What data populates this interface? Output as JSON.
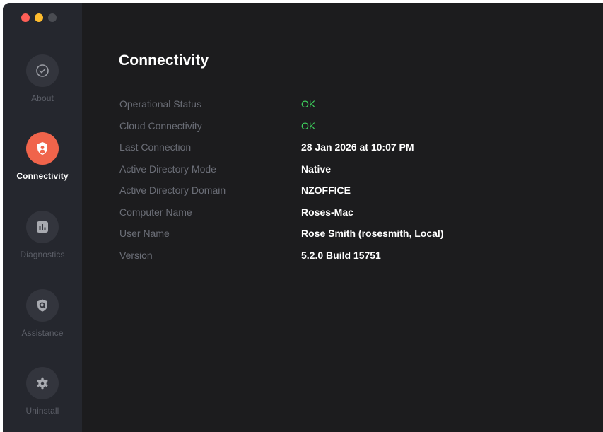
{
  "window": {
    "traffic_lights": [
      {
        "name": "close",
        "color": "#ff5f57"
      },
      {
        "name": "minimize",
        "color": "#febc2e"
      },
      {
        "name": "zoom",
        "color": "#4a4c52"
      }
    ]
  },
  "sidebar": {
    "items": [
      {
        "label": "About",
        "icon": "check-circle-icon",
        "active": false
      },
      {
        "label": "Connectivity",
        "icon": "shield-user-icon",
        "active": true
      },
      {
        "label": "Diagnostics",
        "icon": "bar-chart-icon",
        "active": false
      },
      {
        "label": "Assistance",
        "icon": "shield-search-icon",
        "active": false
      },
      {
        "label": "Uninstall",
        "icon": "gear-icon",
        "active": false
      }
    ]
  },
  "main": {
    "title": "Connectivity",
    "rows": [
      {
        "label": "Operational Status",
        "value": "OK"
      },
      {
        "label": "Cloud Connectivity",
        "value": "OK"
      },
      {
        "label": "Last Connection",
        "value": "28 Jan 2026 at 10:07 PM"
      },
      {
        "label": "Active Directory Mode",
        "value": "Native"
      },
      {
        "label": "Active Directory Domain",
        "value": "NZOFFICE"
      },
      {
        "label": "Computer Name",
        "value": "Roses-Mac"
      },
      {
        "label": "User Name",
        "value": "Rose Smith (rosesmith, Local)"
      },
      {
        "label": "Version",
        "value": "5.2.0 Build 15751"
      }
    ]
  },
  "colors": {
    "accent": "#f0644b",
    "ok_status": "#3ecf5d",
    "sidebar_bg": "#25272e",
    "main_bg": "#1c1c1e"
  }
}
